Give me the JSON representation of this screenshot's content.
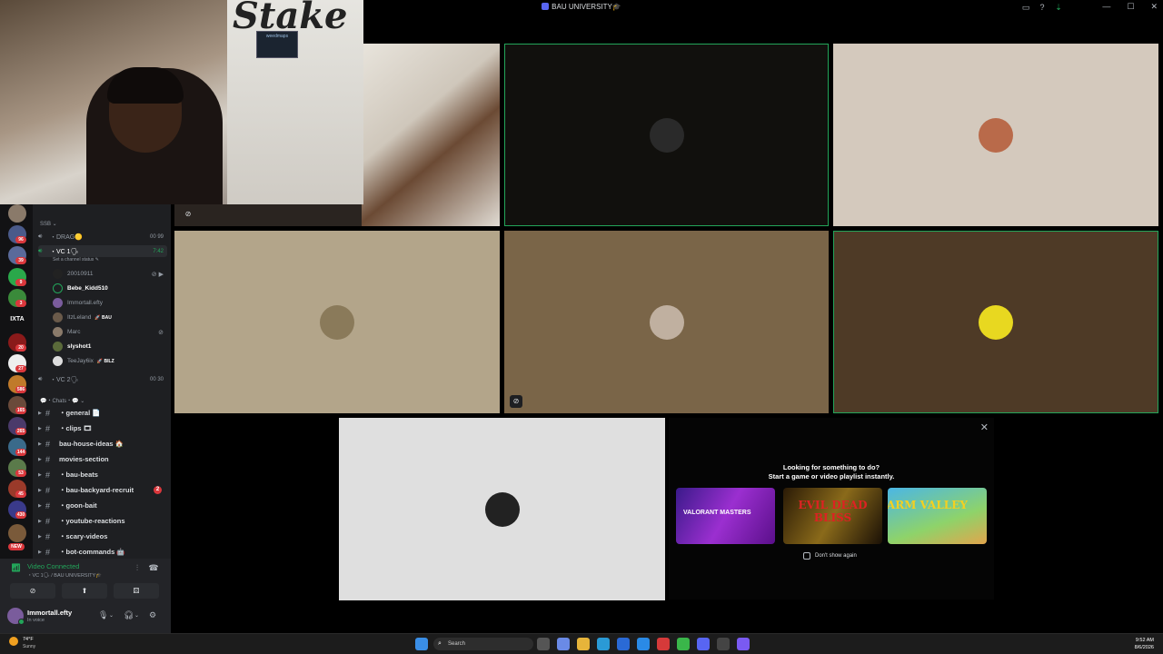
{
  "window": {
    "title": "BAU UNIVERSITY🎓"
  },
  "rail": {
    "badges": [
      "96",
      "39",
      "9",
      "3",
      "20",
      "27",
      "586",
      "165",
      "265",
      "144",
      "53",
      "45",
      "430",
      "NEW"
    ],
    "text_server": "IXTA"
  },
  "channels": {
    "category_top": "SSB ⌄",
    "voice": [
      {
        "label": "・DRAG🟡",
        "count": "00  99"
      },
      {
        "label": "・VC 1🗣",
        "count": "7:42",
        "status": "Set a channel status ✎"
      },
      {
        "label": "・VC 2🗣",
        "count": "00  30"
      }
    ],
    "members": [
      {
        "name": "20010911",
        "bright": false,
        "tag": ""
      },
      {
        "name": "Bebe_Kidd510",
        "bright": true,
        "tag": ""
      },
      {
        "name": "Immortall.efty",
        "bright": false,
        "tag": ""
      },
      {
        "name": "ItzLeland",
        "bright": false,
        "tag": "🚀 BAU"
      },
      {
        "name": "Marc",
        "bright": false,
        "tag": ""
      },
      {
        "name": "slyshot1",
        "bright": true,
        "tag": ""
      },
      {
        "name": "TeeJay6ix",
        "bright": false,
        "tag": "🚀 BILZ"
      }
    ],
    "category_chats": "💬・Chats・💬 ⌄",
    "text_channels": [
      {
        "label": "・general 📄",
        "badge": ""
      },
      {
        "label": "・clips 🎞",
        "badge": ""
      },
      {
        "label": "bau-house-ideas 🏠",
        "badge": ""
      },
      {
        "label": "movies-section",
        "badge": ""
      },
      {
        "label": "・bau-beats",
        "badge": ""
      },
      {
        "label": "・bau-backyard-recruit",
        "badge": "2"
      },
      {
        "label": "・goon-bait",
        "badge": ""
      },
      {
        "label": "・youtube-reactions",
        "badge": ""
      },
      {
        "label": "・scary-videos",
        "badge": ""
      },
      {
        "label": "・bot-commands 🤖",
        "badge": ""
      }
    ]
  },
  "voice_panel": {
    "status": "Video Connected",
    "sub": "・VC 1🗣 / BAU UNIVERSITY🎓",
    "user_name": "Immortall.efty",
    "user_status": "In voice"
  },
  "webcam": {
    "brand": "Stake",
    "sign": "weedmaps"
  },
  "activity": {
    "heading1": "Looking for something to do?",
    "heading2": "Start a game or video playlist instantly.",
    "games": [
      "VALORANT MASTERS",
      "EVIL DEAD BLISS",
      "FARM VALLEY"
    ],
    "dont_show": "Don't show again"
  },
  "taskbar": {
    "weather_temp": "74°F",
    "weather_desc": "Sunny",
    "search_placeholder": "Search",
    "time": "9:52 AM",
    "date": "8/6/2026"
  },
  "colors": {
    "speaking": "#23a55a",
    "badge": "#da373c",
    "accent": "#5865f2"
  }
}
